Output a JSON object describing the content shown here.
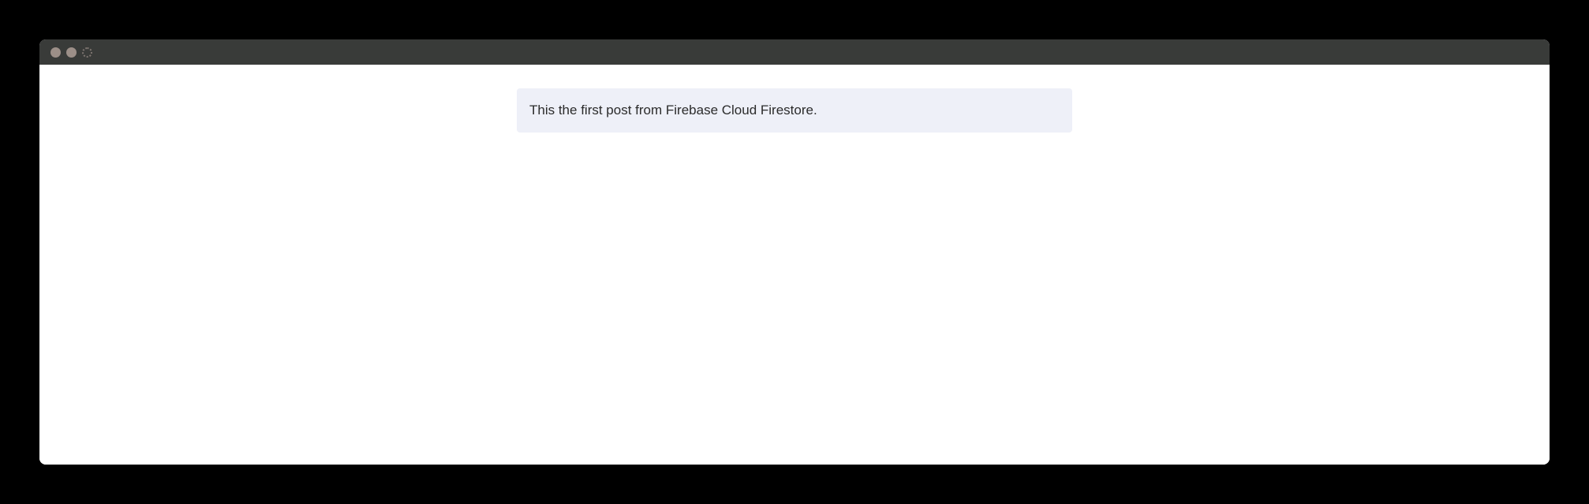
{
  "window": {
    "controls": [
      {
        "name": "close-button",
        "icon": "circle-icon"
      },
      {
        "name": "minimize-button",
        "icon": "circle-icon"
      },
      {
        "name": "zoom-button",
        "icon": "dotted-circle-icon"
      }
    ]
  },
  "posts": [
    {
      "text": "This the first post from Firebase Cloud Firestore."
    }
  ],
  "colors": {
    "titlebar": "#393b39",
    "card_background": "#eef0f8",
    "text": "#2b2b2b"
  }
}
